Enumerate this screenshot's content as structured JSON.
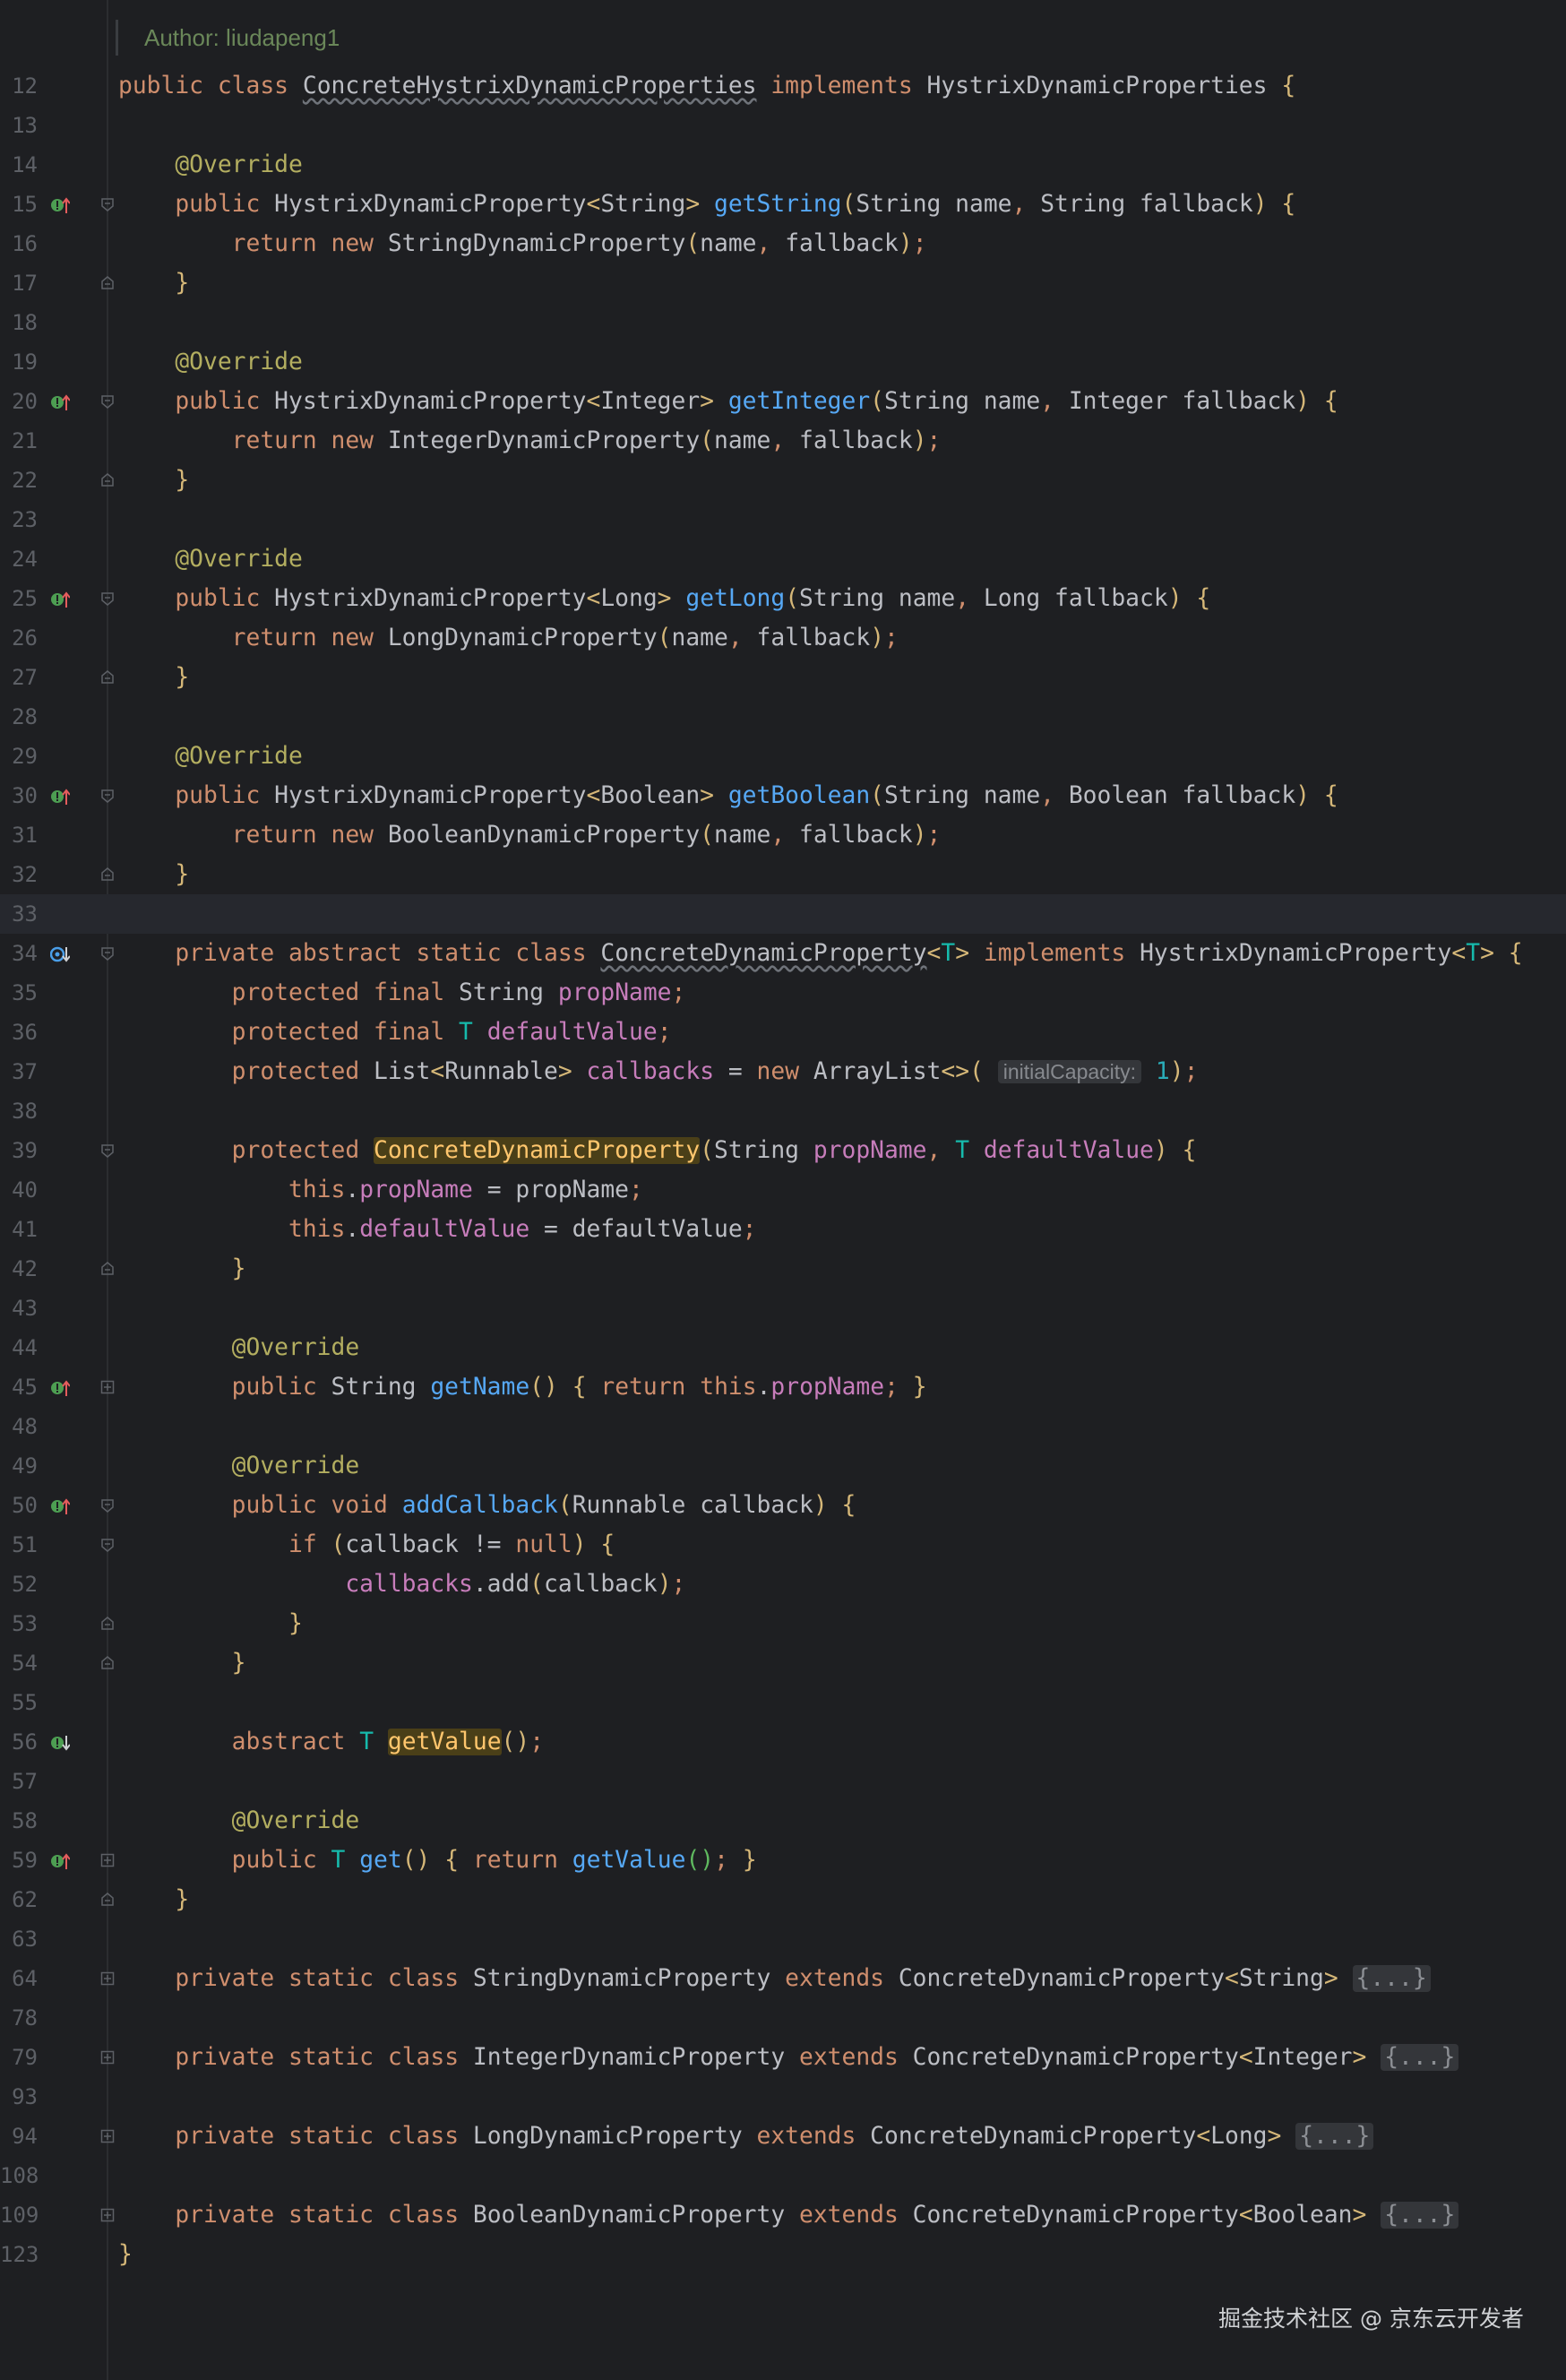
{
  "author": "Author: liudapeng1",
  "watermark": "掘金技术社区 @ 京东云开发者",
  "current_line": "33",
  "lines": [
    {
      "n": "12",
      "t": "public class ConcreteHystrixDynamicProperties implements HystrixDynamicProperties {"
    },
    {
      "n": "13",
      "t": ""
    },
    {
      "n": "14",
      "t": "    @Override"
    },
    {
      "n": "15",
      "t": "    public HystrixDynamicProperty<String> getString(String name, String fallback) {"
    },
    {
      "n": "16",
      "t": "        return new StringDynamicProperty(name, fallback);"
    },
    {
      "n": "17",
      "t": "    }"
    },
    {
      "n": "18",
      "t": ""
    },
    {
      "n": "19",
      "t": "    @Override"
    },
    {
      "n": "20",
      "t": "    public HystrixDynamicProperty<Integer> getInteger(String name, Integer fallback) {"
    },
    {
      "n": "21",
      "t": "        return new IntegerDynamicProperty(name, fallback);"
    },
    {
      "n": "22",
      "t": "    }"
    },
    {
      "n": "23",
      "t": ""
    },
    {
      "n": "24",
      "t": "    @Override"
    },
    {
      "n": "25",
      "t": "    public HystrixDynamicProperty<Long> getLong(String name, Long fallback) {"
    },
    {
      "n": "26",
      "t": "        return new LongDynamicProperty(name, fallback);"
    },
    {
      "n": "27",
      "t": "    }"
    },
    {
      "n": "28",
      "t": ""
    },
    {
      "n": "29",
      "t": "    @Override"
    },
    {
      "n": "30",
      "t": "    public HystrixDynamicProperty<Boolean> getBoolean(String name, Boolean fallback) {"
    },
    {
      "n": "31",
      "t": "        return new BooleanDynamicProperty(name, fallback);"
    },
    {
      "n": "32",
      "t": "    }"
    },
    {
      "n": "33",
      "t": ""
    },
    {
      "n": "34",
      "t": "    private abstract static class ConcreteDynamicProperty<T> implements HystrixDynamicProperty<T> {"
    },
    {
      "n": "35",
      "t": "        protected final String propName;"
    },
    {
      "n": "36",
      "t": "        protected final T defaultValue;"
    },
    {
      "n": "37",
      "t": "        protected List<Runnable> callbacks = new ArrayList<>( initialCapacity: 1);"
    },
    {
      "n": "38",
      "t": ""
    },
    {
      "n": "39",
      "t": "        protected ConcreteDynamicProperty(String propName, T defaultValue) {"
    },
    {
      "n": "40",
      "t": "            this.propName = propName;"
    },
    {
      "n": "41",
      "t": "            this.defaultValue = defaultValue;"
    },
    {
      "n": "42",
      "t": "        }"
    },
    {
      "n": "43",
      "t": ""
    },
    {
      "n": "44",
      "t": "        @Override"
    },
    {
      "n": "45",
      "t": "        public String getName() { return this.propName; }"
    },
    {
      "n": "48",
      "t": ""
    },
    {
      "n": "49",
      "t": "        @Override"
    },
    {
      "n": "50",
      "t": "        public void addCallback(Runnable callback) {"
    },
    {
      "n": "51",
      "t": "            if (callback != null) {"
    },
    {
      "n": "52",
      "t": "                callbacks.add(callback);"
    },
    {
      "n": "53",
      "t": "            }"
    },
    {
      "n": "54",
      "t": "        }"
    },
    {
      "n": "55",
      "t": ""
    },
    {
      "n": "56",
      "t": "        abstract T getValue();"
    },
    {
      "n": "57",
      "t": ""
    },
    {
      "n": "58",
      "t": "        @Override"
    },
    {
      "n": "59",
      "t": "        public T get() { return getValue(); }"
    },
    {
      "n": "62",
      "t": "    }"
    },
    {
      "n": "63",
      "t": ""
    },
    {
      "n": "64",
      "t": "    private static class StringDynamicProperty extends ConcreteDynamicProperty<String> {...}"
    },
    {
      "n": "78",
      "t": ""
    },
    {
      "n": "79",
      "t": "    private static class IntegerDynamicProperty extends ConcreteDynamicProperty<Integer> {...}"
    },
    {
      "n": "93",
      "t": ""
    },
    {
      "n": "94",
      "t": "    private static class LongDynamicProperty extends ConcreteDynamicProperty<Long> {...}"
    },
    {
      "n": "108",
      "t": ""
    },
    {
      "n": "109",
      "t": "    private static class BooleanDynamicProperty extends ConcreteDynamicProperty<Boolean> {...}"
    },
    {
      "n": "123",
      "t": "}"
    }
  ],
  "gutter_icons": {
    "15": "implements-override-up-icon",
    "20": "implements-override-up-icon",
    "25": "implements-override-up-icon",
    "30": "implements-override-up-icon",
    "34": "implemented-class-down-icon",
    "45": "implements-override-up-icon",
    "50": "implements-override-up-icon",
    "56": "implemented-method-down-icon",
    "59": "implements-override-up-icon"
  },
  "fold_markers": {
    "15": "fold-open-icon",
    "17": "fold-close-icon",
    "20": "fold-open-icon",
    "22": "fold-close-icon",
    "25": "fold-open-icon",
    "27": "fold-close-icon",
    "30": "fold-open-icon",
    "32": "fold-close-icon",
    "34": "fold-open-icon",
    "39": "fold-open-icon",
    "42": "fold-close-icon",
    "45": "fold-plus-icon",
    "50": "fold-open-icon",
    "51": "fold-open-icon",
    "53": "fold-close-icon",
    "54": "fold-close-icon",
    "59": "fold-plus-icon",
    "62": "fold-close-icon",
    "64": "fold-plus-icon",
    "79": "fold-plus-icon",
    "94": "fold-plus-icon",
    "109": "fold-plus-icon"
  },
  "colors": {
    "background": "#1e1f22",
    "keyword": "#cf8e6d",
    "annotation": "#b3ae60",
    "method": "#56a8f5",
    "field": "#c77dbb",
    "type_param": "#16baac",
    "number": "#2aacb8",
    "bracket_outer": "#d5b778",
    "bracket_inner": "#5fb95f",
    "bracket_deep": "#4a9ee8",
    "gutter_icon_green": "#4d9e52",
    "gutter_icon_red": "#e55d5d",
    "gutter_icon_blue": "#4a9ee8"
  }
}
